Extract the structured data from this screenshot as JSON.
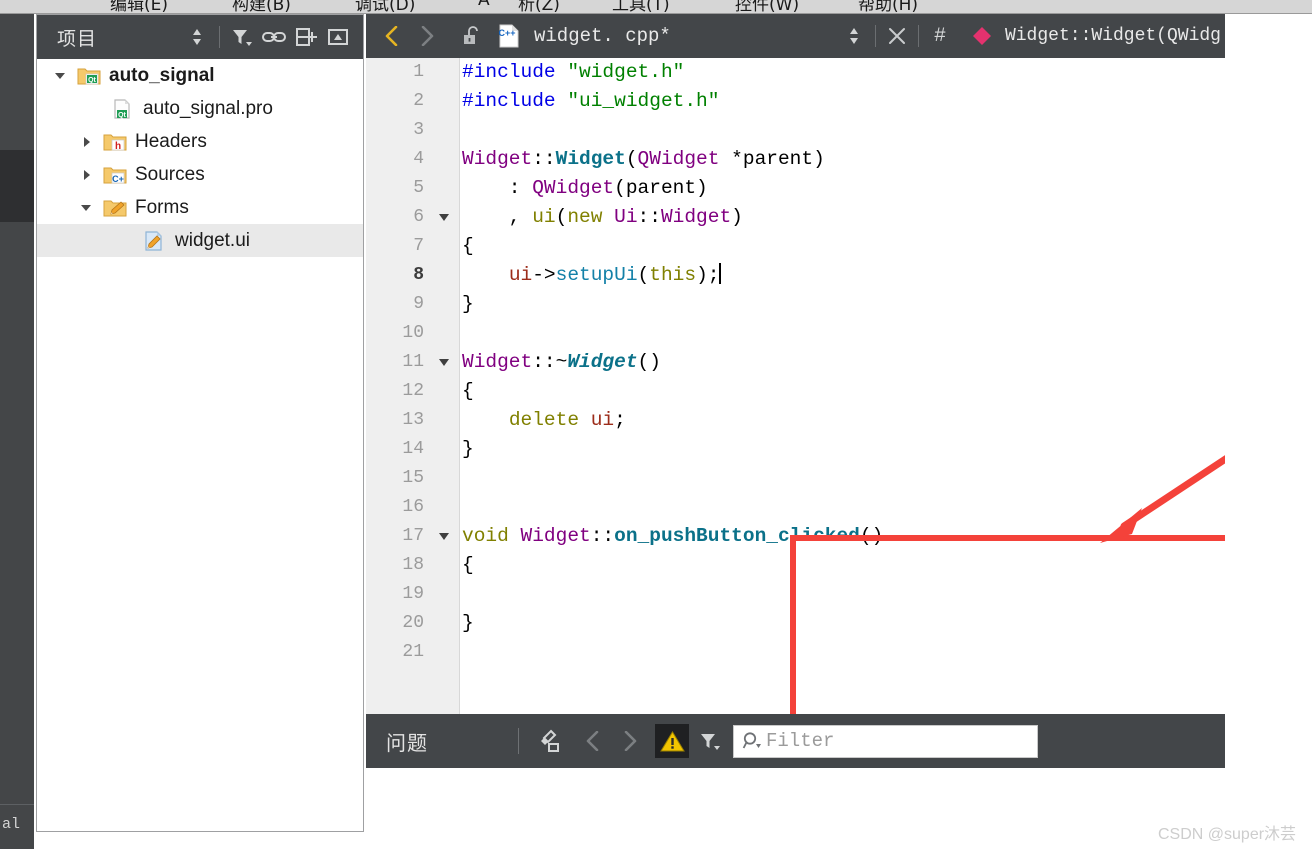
{
  "menubar": {
    "items": [
      "编辑(E)",
      "构建(B)",
      "调试(D)",
      "A",
      "析(Z)",
      "工具(T)",
      "控件(W)",
      "帮助(H)"
    ]
  },
  "mode_strip": {
    "label": "al"
  },
  "project_panel": {
    "title": "项目",
    "tools": [
      {
        "name": "sync-with-editor-icon",
        "glyph": "updown"
      },
      {
        "name": "filter-icon",
        "glyph": "filter"
      },
      {
        "name": "link-icon",
        "glyph": "link"
      },
      {
        "name": "split-add-icon",
        "glyph": "splitadd"
      },
      {
        "name": "collapse-icon",
        "glyph": "collapse"
      }
    ],
    "tree": [
      {
        "label": "auto_signal",
        "icon": "qt-project-folder-icon",
        "indent": 0,
        "arrow": "down",
        "bold": true,
        "selected": false
      },
      {
        "label": "auto_signal.pro",
        "icon": "qt-pro-file-icon",
        "indent": 1,
        "arrow": "none",
        "bold": false,
        "selected": false
      },
      {
        "label": "Headers",
        "icon": "headers-folder-icon",
        "indent": 1,
        "arrow": "right",
        "bold": false,
        "selected": false
      },
      {
        "label": "Sources",
        "icon": "sources-folder-icon",
        "indent": 1,
        "arrow": "right",
        "bold": false,
        "selected": false
      },
      {
        "label": "Forms",
        "icon": "forms-folder-icon",
        "indent": 1,
        "arrow": "down",
        "bold": false,
        "selected": false
      },
      {
        "label": "widget.ui",
        "icon": "ui-file-icon",
        "indent": 2,
        "arrow": "none",
        "bold": false,
        "selected": true
      }
    ]
  },
  "editor": {
    "tab": {
      "back_icon": "chevron-left-icon",
      "forward_icon": "chevron-right-icon",
      "lock_icon": "unlocked-padlock-icon",
      "file_icon": "cpp-file-icon",
      "filename": "widget. cpp*",
      "updown_icon": "updown-icon",
      "close_icon": "close-icon",
      "hash_icon": "#",
      "symbol_marker": "class-diamond-icon",
      "symbol": "Widget::Widget(QWidg"
    },
    "current_line": 8,
    "lines": [
      {
        "n": 1,
        "fold": "none",
        "tokens": [
          {
            "c": "t-pre",
            "t": "#include "
          },
          {
            "c": "t-str",
            "t": "\"widget.h\""
          }
        ]
      },
      {
        "n": 2,
        "fold": "none",
        "tokens": [
          {
            "c": "t-pre",
            "t": "#include "
          },
          {
            "c": "t-str",
            "t": "\"ui_widget.h\""
          }
        ]
      },
      {
        "n": 3,
        "fold": "none",
        "tokens": []
      },
      {
        "n": 4,
        "fold": "none",
        "tokens": [
          {
            "c": "t-type",
            "t": "Widget"
          },
          {
            "c": "t-plain",
            "t": "::"
          },
          {
            "c": "t-func",
            "t": "Widget"
          },
          {
            "c": "t-plain",
            "t": "("
          },
          {
            "c": "t-type",
            "t": "QWidget"
          },
          {
            "c": "t-plain",
            "t": " *parent)"
          }
        ]
      },
      {
        "n": 5,
        "fold": "none",
        "tokens": [
          {
            "c": "t-plain",
            "t": "    : "
          },
          {
            "c": "t-type",
            "t": "QWidget"
          },
          {
            "c": "t-plain",
            "t": "(parent)"
          }
        ]
      },
      {
        "n": 6,
        "fold": "down",
        "tokens": [
          {
            "c": "t-plain",
            "t": "    , "
          },
          {
            "c": "t-var",
            "t": "ui"
          },
          {
            "c": "t-plain",
            "t": "("
          },
          {
            "c": "t-kw",
            "t": "new"
          },
          {
            "c": "t-plain",
            "t": " "
          },
          {
            "c": "t-type",
            "t": "Ui"
          },
          {
            "c": "t-plain",
            "t": "::"
          },
          {
            "c": "t-type",
            "t": "Widget"
          },
          {
            "c": "t-plain",
            "t": ")"
          }
        ]
      },
      {
        "n": 7,
        "fold": "none",
        "tokens": [
          {
            "c": "t-plain",
            "t": "{"
          }
        ]
      },
      {
        "n": 8,
        "fold": "none",
        "tokens": [
          {
            "c": "t-plain",
            "t": "    "
          },
          {
            "c": "t-local",
            "t": "ui"
          },
          {
            "c": "t-plain",
            "t": "->"
          },
          {
            "c": "t-fn2",
            "t": "setupUi"
          },
          {
            "c": "t-plain",
            "t": "("
          },
          {
            "c": "t-kw",
            "t": "this"
          },
          {
            "c": "t-plain",
            "t": ");"
          }
        ],
        "caret": true
      },
      {
        "n": 9,
        "fold": "none",
        "tokens": [
          {
            "c": "t-plain",
            "t": "}"
          }
        ]
      },
      {
        "n": 10,
        "fold": "none",
        "tokens": []
      },
      {
        "n": 11,
        "fold": "down",
        "tokens": [
          {
            "c": "t-type",
            "t": "Widget"
          },
          {
            "c": "t-plain",
            "t": "::~"
          },
          {
            "c": "t-funci",
            "t": "Widget"
          },
          {
            "c": "t-plain",
            "t": "()"
          }
        ]
      },
      {
        "n": 12,
        "fold": "none",
        "tokens": [
          {
            "c": "t-plain",
            "t": "{"
          }
        ]
      },
      {
        "n": 13,
        "fold": "none",
        "tokens": [
          {
            "c": "t-plain",
            "t": "    "
          },
          {
            "c": "t-kw",
            "t": "delete"
          },
          {
            "c": "t-plain",
            "t": " "
          },
          {
            "c": "t-local",
            "t": "ui"
          },
          {
            "c": "t-plain",
            "t": ";"
          }
        ]
      },
      {
        "n": 14,
        "fold": "none",
        "tokens": [
          {
            "c": "t-plain",
            "t": "}"
          }
        ]
      },
      {
        "n": 15,
        "fold": "none",
        "tokens": []
      },
      {
        "n": 16,
        "fold": "none",
        "tokens": []
      },
      {
        "n": 17,
        "fold": "down",
        "tokens": [
          {
            "c": "t-void",
            "t": "void"
          },
          {
            "c": "t-plain",
            "t": " "
          },
          {
            "c": "t-type",
            "t": "Widget"
          },
          {
            "c": "t-plain",
            "t": "::"
          },
          {
            "c": "t-func",
            "t": "on_pushButton_clicked"
          },
          {
            "c": "t-plain",
            "t": "()"
          }
        ]
      },
      {
        "n": 18,
        "fold": "none",
        "tokens": [
          {
            "c": "t-plain",
            "t": "{"
          }
        ]
      },
      {
        "n": 19,
        "fold": "none",
        "tokens": []
      },
      {
        "n": 20,
        "fold": "none",
        "tokens": [
          {
            "c": "t-plain",
            "t": "}"
          }
        ]
      },
      {
        "n": 21,
        "fold": "none",
        "tokens": []
      }
    ]
  },
  "annotation": {
    "rect_color": "#f4423a",
    "arrow_color": "#f4423a"
  },
  "issues_panel": {
    "title": "问题",
    "clear_icon": "clear-icon",
    "prev_icon": "chevron-left-icon",
    "next_icon": "chevron-right-icon",
    "warning_icon": "warning-triangle-icon",
    "filter_icon": "filter-icon",
    "search_icon": "search-icon",
    "filter_placeholder": "Filter",
    "filter_value": ""
  },
  "watermark": {
    "text": "CSDN @super沐芸"
  }
}
